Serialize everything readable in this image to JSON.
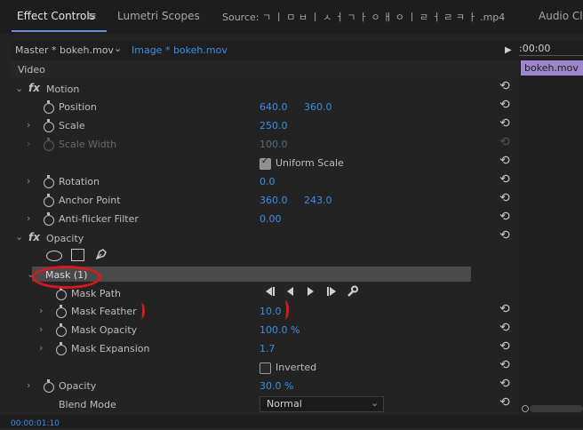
{
  "tabs": {
    "effect_controls": "Effect Controls",
    "menu_icon": "≡",
    "lumetri": "Lumetri Scopes",
    "source": "Source: ㄱ ㅣ ㅁ ㅂ ㅣ ㅅ ㅓ ㄱ ㅏ ㅇ ㅐ ㅇ ㅣ ㄹ ㅓ ㄹ ㅋ ㅏ .mp4",
    "audio": "Audio Clip"
  },
  "crumb": {
    "master": "Master * bokeh.mov",
    "clip": "Image * bokeh.mov",
    "chevron": "⌄",
    "play": "▶"
  },
  "timeline": {
    "time": ":00:00",
    "clip": "bokeh.mov",
    "timecode": "00:00:01:10"
  },
  "section": "Video",
  "motion": {
    "fx": "fx",
    "title": "Motion",
    "position": {
      "label": "Position",
      "x": "640.0",
      "y": "360.0"
    },
    "scale": {
      "label": "Scale",
      "value": "250.0"
    },
    "scale_width": {
      "label": "Scale Width",
      "value": "100.0"
    },
    "uniform_scale": "Uniform Scale",
    "rotation": {
      "label": "Rotation",
      "value": "0.0"
    },
    "anchor": {
      "label": "Anchor Point",
      "x": "360.0",
      "y": "243.0"
    },
    "antiflicker": {
      "label": "Anti-flicker Filter",
      "value": "0.00"
    }
  },
  "opacity": {
    "fx": "fx",
    "title": "Opacity",
    "mask": "Mask (1)",
    "mask_path": "Mask Path",
    "mask_feather": {
      "label": "Mask Feather",
      "value": "10.0"
    },
    "mask_opacity": {
      "label": "Mask Opacity",
      "value": "100.0 %"
    },
    "mask_expansion": {
      "label": "Mask Expansion",
      "value": "1.7"
    },
    "inverted": "Inverted",
    "opacity": {
      "label": "Opacity",
      "value": "30.0 %"
    },
    "blend": {
      "label": "Blend Mode",
      "value": "Normal"
    }
  },
  "colors": {
    "accent": "#3d8fe3",
    "clip": "#9b87c9",
    "annotation": "#e0161c"
  },
  "icons": {
    "reset": "⟲"
  }
}
